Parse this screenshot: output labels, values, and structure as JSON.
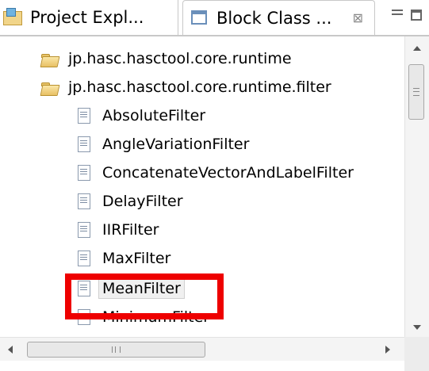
{
  "tabs": {
    "project_explorer": "Project Expl...",
    "block_class": "Block Class ...",
    "close_glyph": "⊠"
  },
  "tree": {
    "packages": [
      "jp.hasc.hasctool.core.runtime",
      "jp.hasc.hasctool.core.runtime.filter"
    ],
    "classes": [
      "AbsoluteFilter",
      "AngleVariationFilter",
      "ConcatenateVectorAndLabelFilter",
      "DelayFilter",
      "IIRFilter",
      "MaxFilter",
      "MeanFilter",
      "MinimumFilter"
    ],
    "selected_class": "MeanFilter"
  },
  "colors": {
    "highlight_border": "#ee0000",
    "selection_bg": "#f0f0f0"
  },
  "icons": {
    "package": "folder-icon",
    "class": "class-file-icon"
  }
}
